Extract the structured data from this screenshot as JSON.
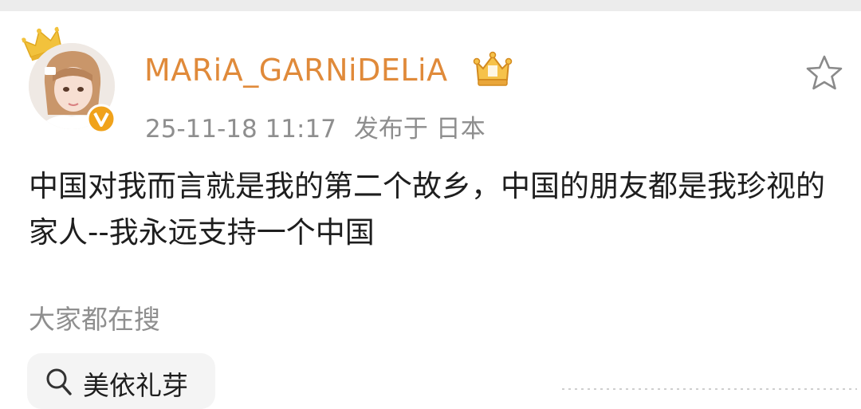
{
  "post": {
    "username": "MARiA_GARNiDELiA",
    "timestamp": "25-11-18 11:17",
    "location": "发布于 日本",
    "content": "中国对我而言就是我的第二个故乡，中国的朋友都是我珍视的家人--我永远支持一个中国"
  },
  "icons": {
    "crown": "crown-icon",
    "verified": "verified-v-badge-icon",
    "member_badge": "vip-crown-badge-icon",
    "favorite": "star-outline-icon",
    "search": "search-icon"
  },
  "search_section": {
    "label": "大家都在搜",
    "items": [
      {
        "label": "美依礼芽"
      }
    ]
  },
  "colors": {
    "username": "#e08a3a",
    "meta": "#8e8e8e",
    "text": "#1e1e1e",
    "chip_bg": "#f4f4f4",
    "crown": "#f2c23c",
    "verified": "#f0a21b"
  }
}
